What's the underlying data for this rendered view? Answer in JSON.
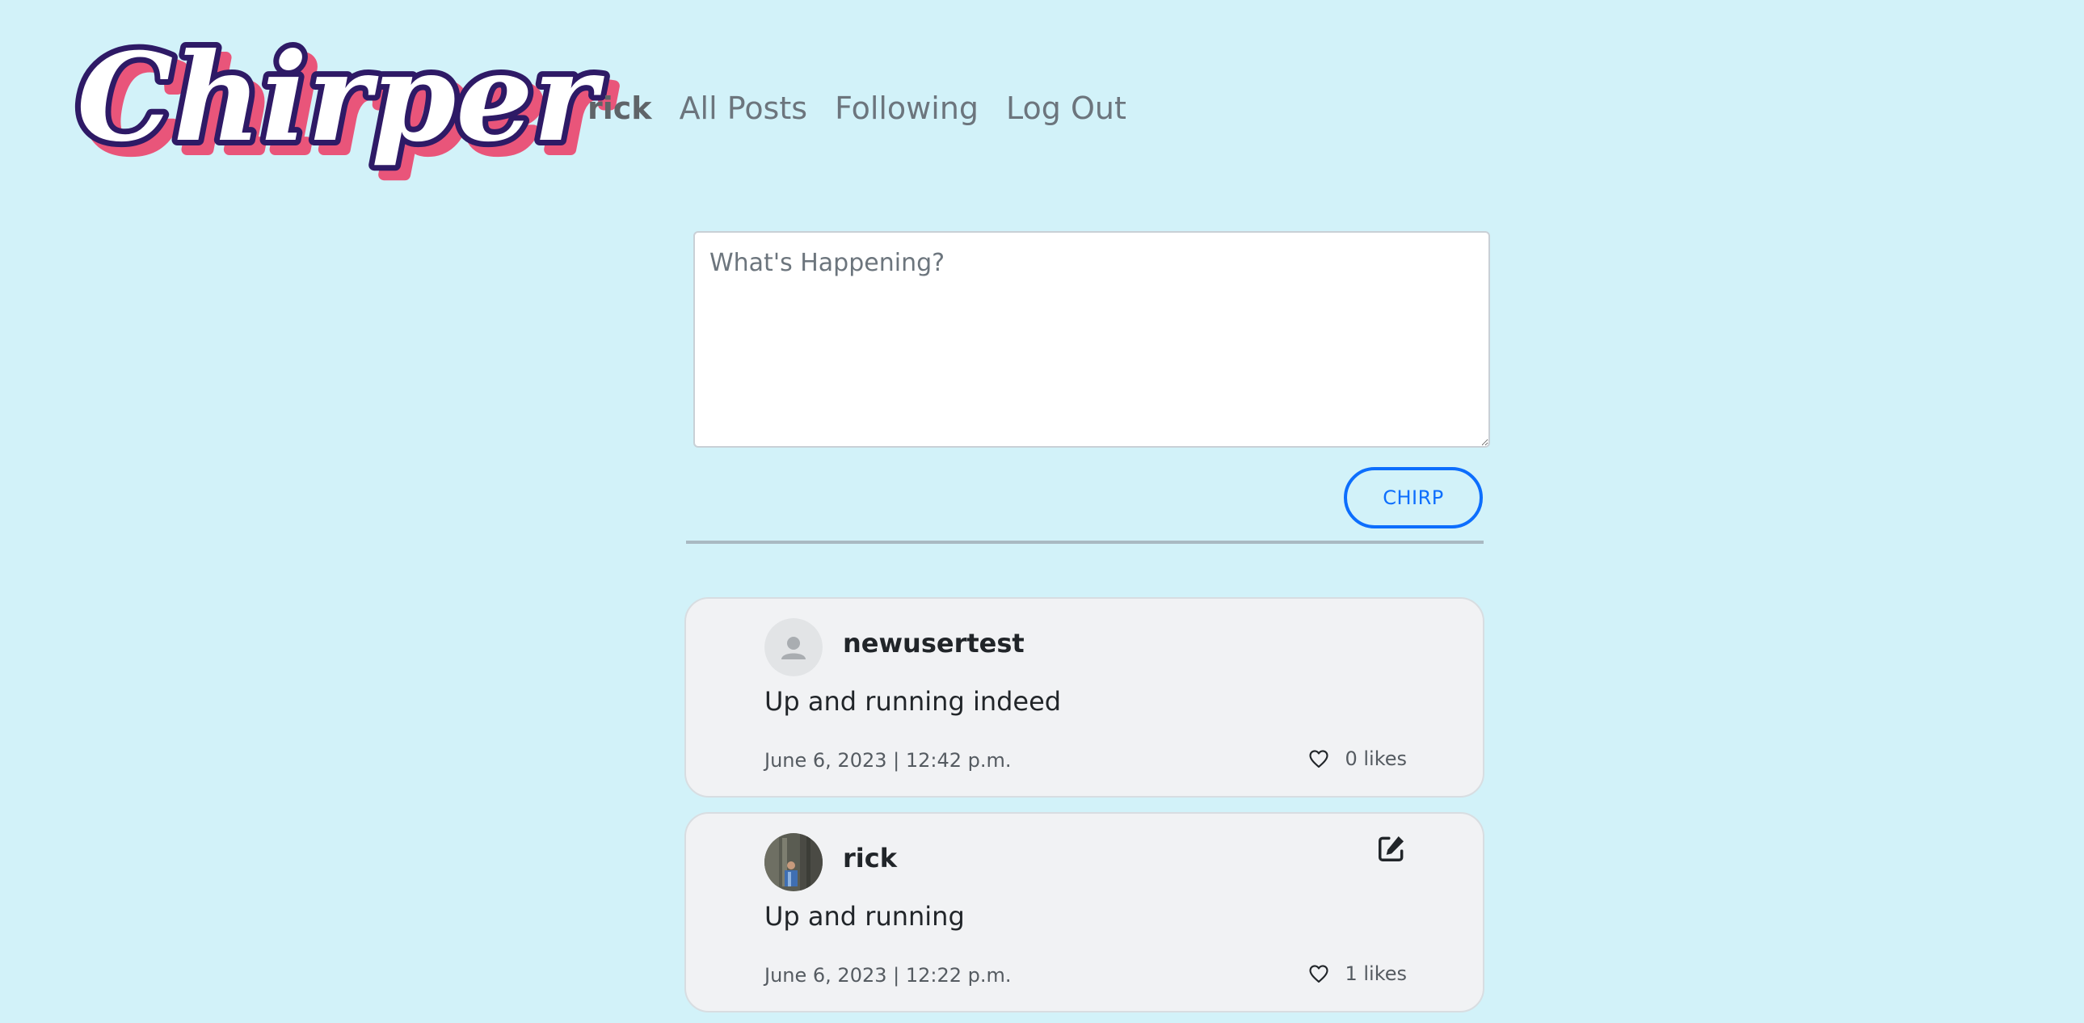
{
  "logo": {
    "text": "Chirper",
    "colors": {
      "shadow": "#e9557a",
      "outline": "#2e1a66",
      "fill": "#ffffff"
    }
  },
  "nav": {
    "items": [
      {
        "label": "rick",
        "active": true
      },
      {
        "label": "All Posts",
        "active": false
      },
      {
        "label": "Following",
        "active": false
      },
      {
        "label": "Log Out",
        "active": false
      }
    ]
  },
  "compose": {
    "placeholder": "What's Happening?",
    "value": "",
    "submit_label": "CHIRP"
  },
  "posts": [
    {
      "username": "newusertest",
      "avatar": "default-user-icon",
      "content": "Up and running indeed",
      "timestamp": "June 6, 2023 | 12:42 p.m.",
      "likes": "0 likes",
      "editable": false
    },
    {
      "username": "rick",
      "avatar": "user-photo",
      "content": "Up and running",
      "timestamp": "June 6, 2023 | 12:22 p.m.",
      "likes": "1 likes",
      "editable": true
    }
  ],
  "colors": {
    "background": "#d2f2f9",
    "accent": "#0d6efd",
    "card": "#f1f2f4",
    "nav_text": "#6c757d"
  }
}
